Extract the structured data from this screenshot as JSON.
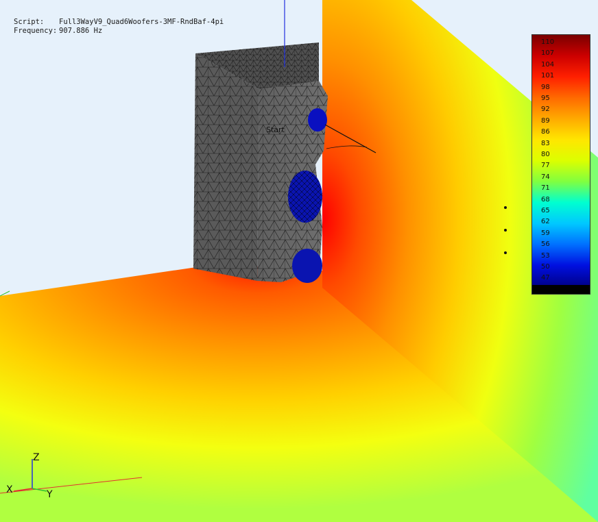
{
  "info": {
    "script_label": "Script:",
    "script_value": "Full3WayV9_Quad6Woofers-3MF-RndBaf-4pi",
    "frequency_label": "Frequency:",
    "frequency_value": "907.886 Hz"
  },
  "scene": {
    "annotation": "Start"
  },
  "legend": {
    "ticks": [
      "110",
      "107",
      "104",
      "101",
      "98",
      "95",
      "92",
      "89",
      "86",
      "83",
      "80",
      "77",
      "74",
      "71",
      "68",
      "65",
      "62",
      "59",
      "56",
      "53",
      "50",
      "47"
    ],
    "colors": [
      "#7a0000",
      "#cc0000",
      "#ff2000",
      "#ff6a00",
      "#ffaa00",
      "#ffe600",
      "#dcff00",
      "#80ff40",
      "#00ffd0",
      "#00c8ff",
      "#0070ff",
      "#0010e0",
      "#00008a"
    ]
  },
  "axes": {
    "x_label": "X",
    "y_label": "Y",
    "z_label": "Z"
  }
}
